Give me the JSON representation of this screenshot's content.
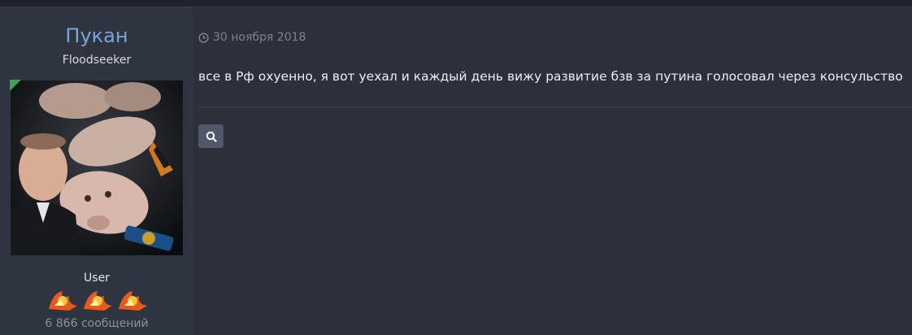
{
  "author": {
    "name": "Пукан",
    "title": "Floodseeker",
    "role": "User",
    "post_count": "6 866 сообщений",
    "online": true,
    "rank_icon": "flame-bird-icon",
    "rank_icon_count": 3
  },
  "post": {
    "date": "30 ноября 2018",
    "date_icon": "clock-icon",
    "message": "все в Рф охуенно, я вот уехал и каждый день вижу развитие бзв за путина голосовал через консульство",
    "search_icon": "search-icon"
  },
  "colors": {
    "background": "#2b303b",
    "author_name": "#7ba4dc",
    "online_indicator": "#3aa655",
    "button": "#50586a"
  }
}
